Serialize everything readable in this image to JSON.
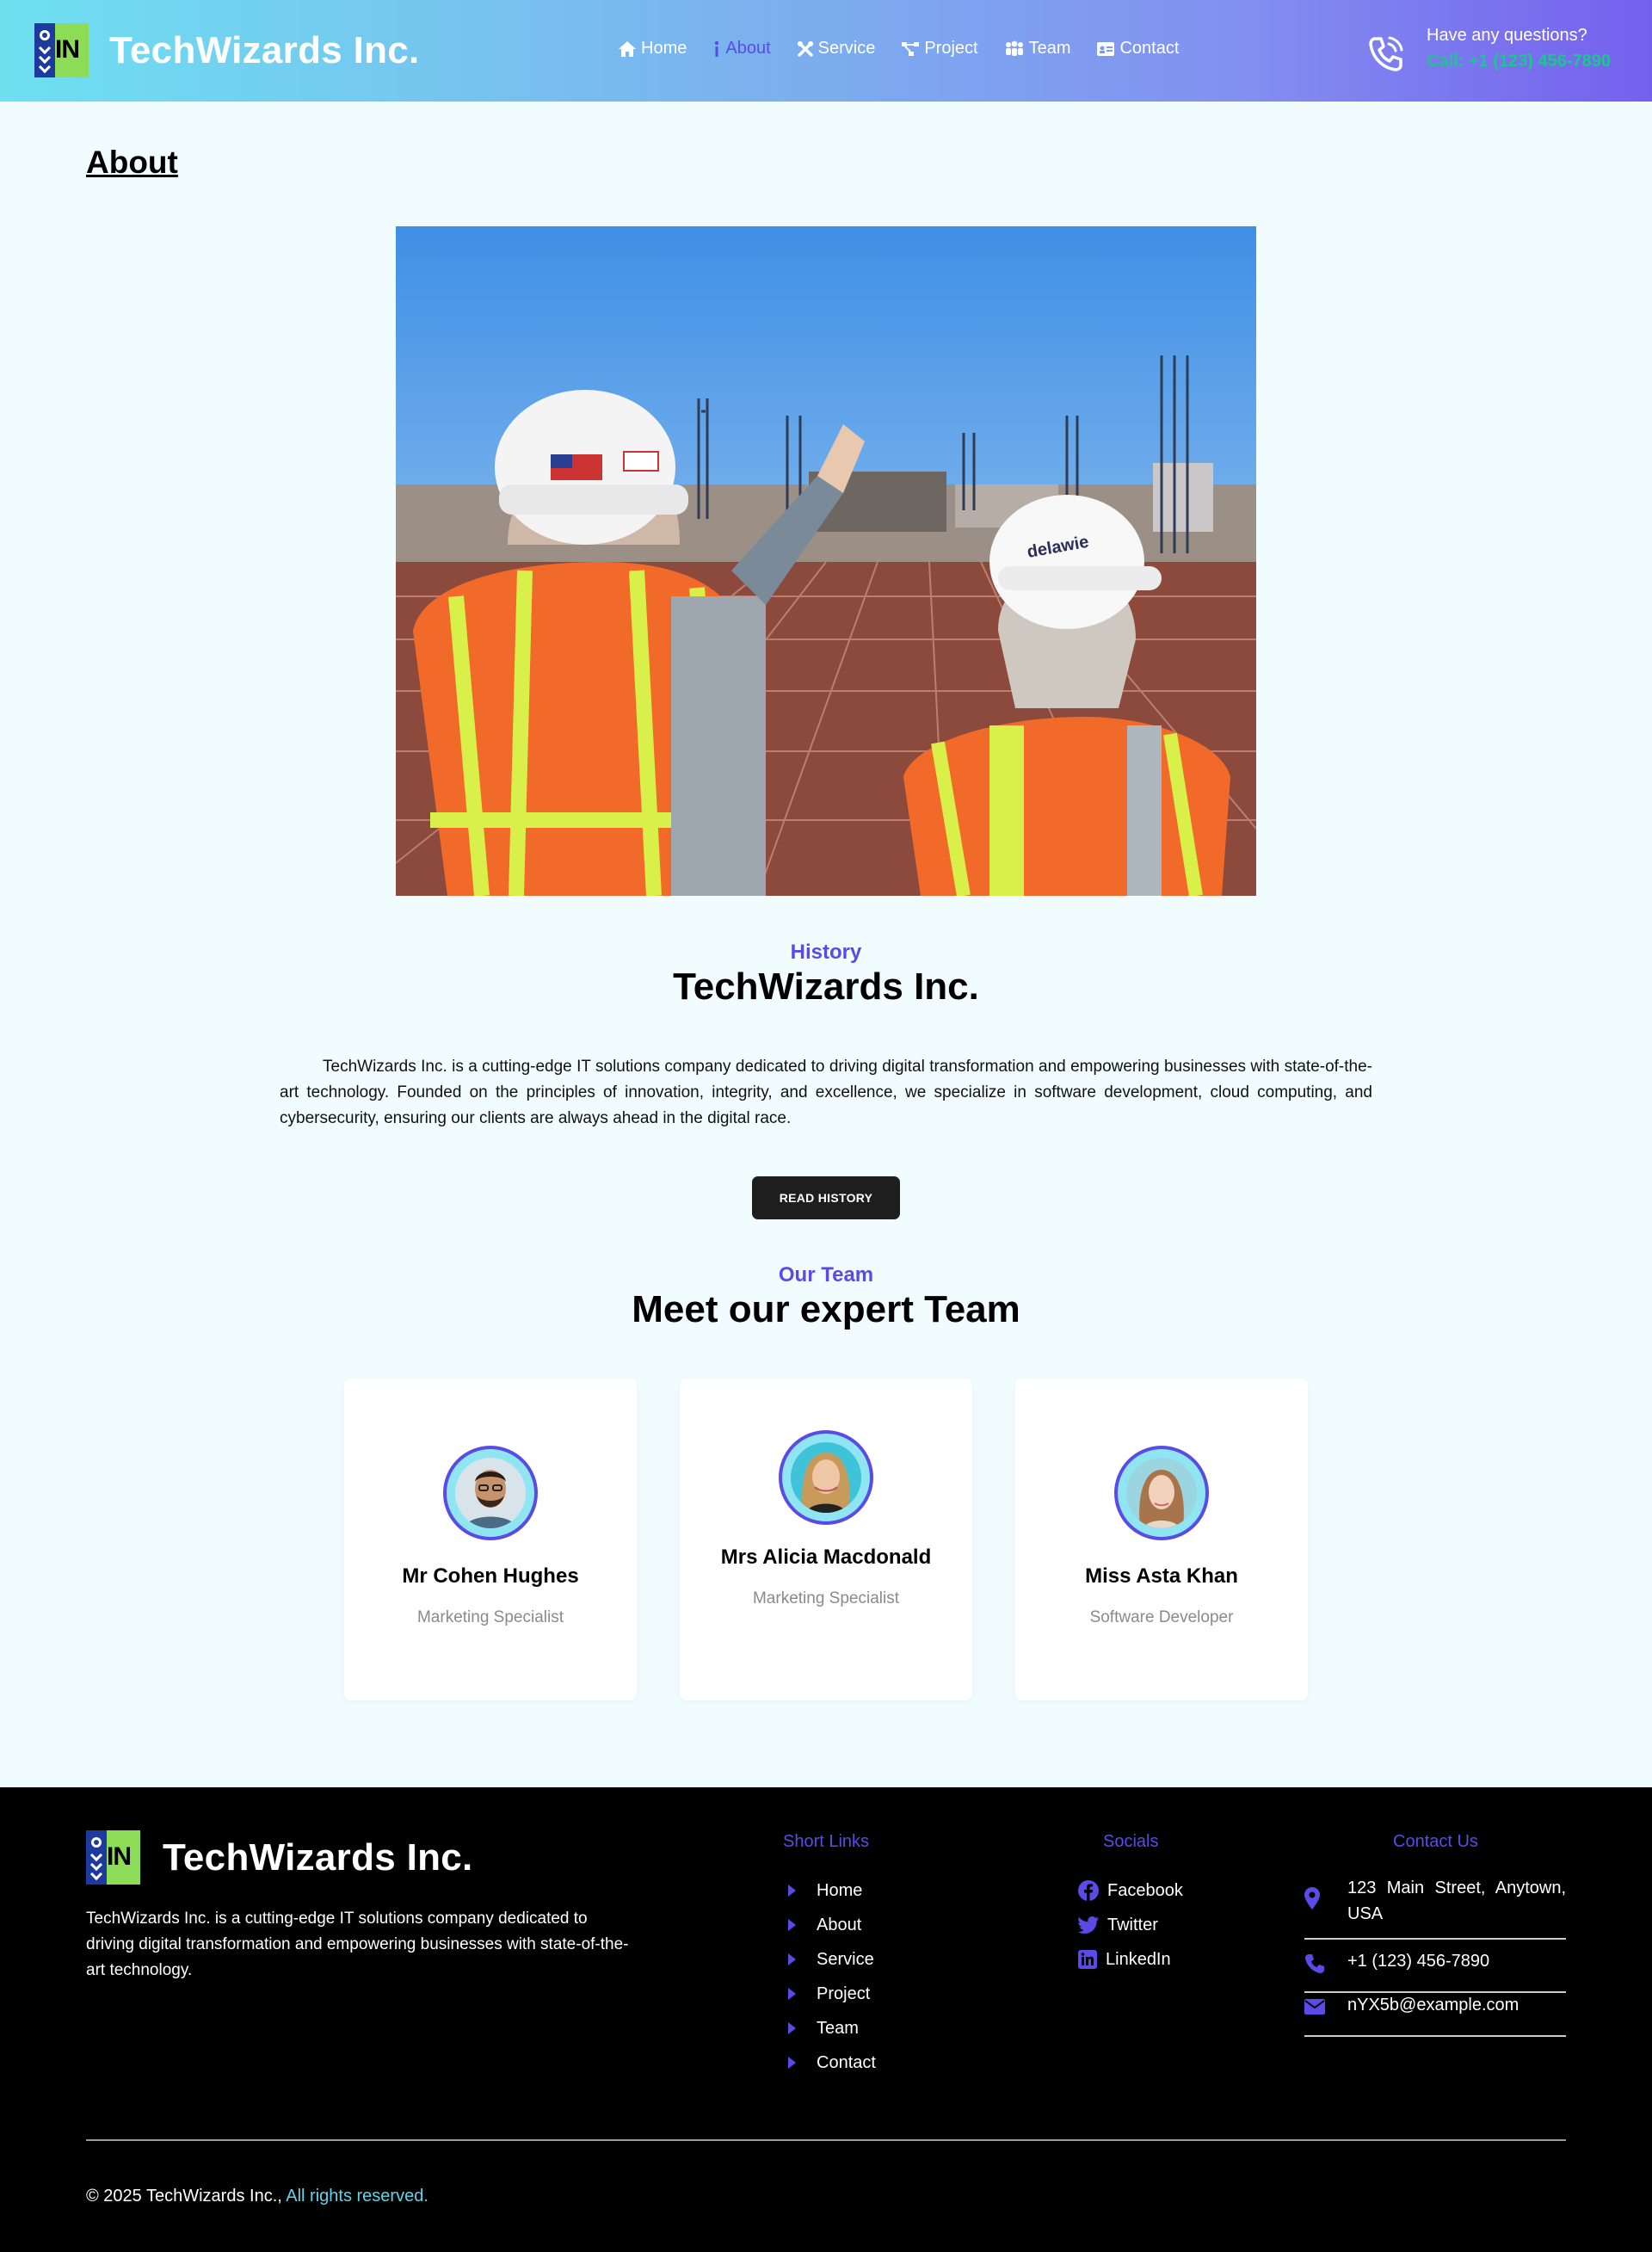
{
  "brand": {
    "name": "TechWizards Inc.",
    "logo_text": "IN"
  },
  "nav": [
    {
      "label": "Home",
      "icon": "home-icon"
    },
    {
      "label": "About",
      "icon": "info-icon",
      "active": true
    },
    {
      "label": "Service",
      "icon": "tools-icon"
    },
    {
      "label": "Project",
      "icon": "project-icon"
    },
    {
      "label": "Team",
      "icon": "team-icon"
    },
    {
      "label": "Contact",
      "icon": "contact-card-icon"
    }
  ],
  "header_contact": {
    "question": "Have any questions?",
    "call": "Call: +1 (123) 456-7890"
  },
  "page_title": "About",
  "history": {
    "tag": "History",
    "heading": "TechWizards Inc.",
    "text": "TechWizards Inc. is a cutting-edge IT solutions company dedicated to driving digital transformation and empowering businesses with state-of-the-art technology. Founded on the principles of innovation, integrity, and excellence, we specialize in software development, cloud computing, and cybersecurity, ensuring our clients are always ahead in the digital race.",
    "button": "READ HISTORY"
  },
  "team": {
    "tag": "Our Team",
    "heading": "Meet our expert Team",
    "members": [
      {
        "name": "Mr Cohen Hughes",
        "role": "Marketing Specialist"
      },
      {
        "name": "Mrs Alicia Macdonald",
        "role": "Marketing Specialist"
      },
      {
        "name": "Miss Asta Khan",
        "role": "Software Developer"
      }
    ]
  },
  "footer": {
    "about": "TechWizards Inc. is a cutting-edge IT solutions company dedicated to driving digital transformation and empowering businesses with state-of-the-art technology.",
    "short_links_title": "Short Links",
    "short_links": [
      "Home",
      "About",
      "Service",
      "Project",
      "Team",
      "Contact"
    ],
    "socials_title": "Socials",
    "socials": [
      "Facebook",
      "Twitter",
      "LinkedIn"
    ],
    "contact_title": "Contact Us",
    "address": "123 Main Street, Anytown, USA",
    "phone": "+1 (123) 456-7890",
    "email": "nYX5b@example.com",
    "copyright": "© 2025 TechWizards Inc.,",
    "rights": "All rights reserved."
  },
  "colors": {
    "accent": "#5b4be6",
    "call_green": "#19c78f",
    "cyan_link": "#5fd5ea",
    "button_dark": "#1e1e1e"
  }
}
